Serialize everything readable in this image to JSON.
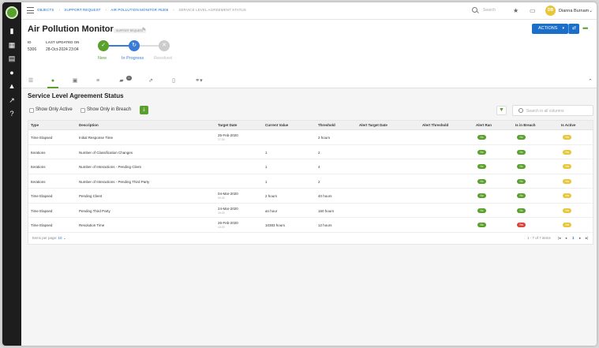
{
  "topbar": {
    "breadcrumbs": [
      "OBJECTS",
      "SUPPORT REQUEST",
      "AIR POLLUTION MONITOR #5306",
      "SERVICE LEVEL AGREEMENT STATUS"
    ],
    "search_placeholder": "Search",
    "user_initials": "DB",
    "user_name": "Dianna Burnam"
  },
  "record": {
    "title": "Air Pollution Monitor",
    "type_badge": "SUPPORT REQUEST",
    "id_label": "ID",
    "id_value": "5306",
    "updated_label": "LAST UPDATED ON",
    "updated_value": "28-Oct-2024 23:04",
    "steps": [
      {
        "label": "New",
        "state": "done"
      },
      {
        "label": "In Progress",
        "state": "current"
      },
      {
        "label": "Resolved",
        "state": "pending"
      }
    ],
    "actions_label": "ACTIONS"
  },
  "tabs": {
    "icons": [
      "list-icon",
      "sla-icon",
      "inbox-icon",
      "details-icon",
      "comments-icon",
      "external-icon",
      "document-icon",
      "link-icon"
    ],
    "comments_badge": "0"
  },
  "sla": {
    "section_title": "Service Level Agreement Status",
    "show_only_active": "Show Only Active",
    "show_only_breach": "Show Only in Breach",
    "search_placeholder": "Search in all columns",
    "columns": [
      "Type",
      "Description",
      "Target Date",
      "Current Value",
      "Threshold",
      "Alert Target Date",
      "Alert Threshold",
      "Alert Ran",
      "Is in Breach",
      "Is Active"
    ],
    "rows": [
      {
        "type": "Time Elapsed",
        "description": "Initial Response Time",
        "target_date": "25-Feb-2020",
        "target_time": "17:30",
        "current": "",
        "threshold": "2 hours",
        "alert_target": "",
        "alert_threshold": "",
        "alert_ran": "No",
        "in_breach": "No",
        "is_active": "Yes"
      },
      {
        "type": "Iterations",
        "description": "Number of Classification Changes",
        "target_date": "",
        "target_time": "",
        "current": "1",
        "threshold": "2",
        "alert_target": "",
        "alert_threshold": "",
        "alert_ran": "No",
        "in_breach": "No",
        "is_active": "Yes"
      },
      {
        "type": "Iterations",
        "description": "Number of Interactions - Pending Client",
        "target_date": "",
        "target_time": "",
        "current": "1",
        "threshold": "4",
        "alert_target": "",
        "alert_threshold": "",
        "alert_ran": "No",
        "in_breach": "No",
        "is_active": "Yes"
      },
      {
        "type": "Iterations",
        "description": "Number of Interactions - Pending Third Party",
        "target_date": "",
        "target_time": "",
        "current": "1",
        "threshold": "2",
        "alert_target": "",
        "alert_threshold": "",
        "alert_ran": "No",
        "in_breach": "No",
        "is_active": "Yes"
      },
      {
        "type": "Time Elapsed",
        "description": "Pending Client",
        "target_date": "04-Mar-2020",
        "target_time": "09:30",
        "current": "2 hours",
        "threshold": "40 hours",
        "alert_target": "",
        "alert_threshold": "",
        "alert_ran": "No",
        "in_breach": "No",
        "is_active": "Yes"
      },
      {
        "type": "Time Elapsed",
        "description": "Pending Third Party",
        "target_date": "24-Mar-2020",
        "target_time": "15:30",
        "current": "an hour",
        "threshold": "160 hours",
        "alert_target": "",
        "alert_threshold": "",
        "alert_ran": "No",
        "in_breach": "No",
        "is_active": "Yes"
      },
      {
        "type": "Time Elapsed",
        "description": "Resolution Time",
        "target_date": "26-Feb-2020",
        "target_time": "15:20",
        "current": "10383 hours",
        "threshold": "12 hours",
        "alert_target": "",
        "alert_threshold": "",
        "alert_ran": "No",
        "in_breach": "Yes",
        "is_active": "Yes"
      }
    ],
    "footer": {
      "items_per_page_label": "Items per page:",
      "items_per_page": "10",
      "range": "1 - 7 of 7 items",
      "page": "1"
    }
  },
  "colors": {
    "accent": "#1b6fc9",
    "green": "#5aa02c",
    "no_pill": "#5aa02c",
    "yes_pill": "#e8c63a",
    "breach_pill": "#d9453b"
  }
}
